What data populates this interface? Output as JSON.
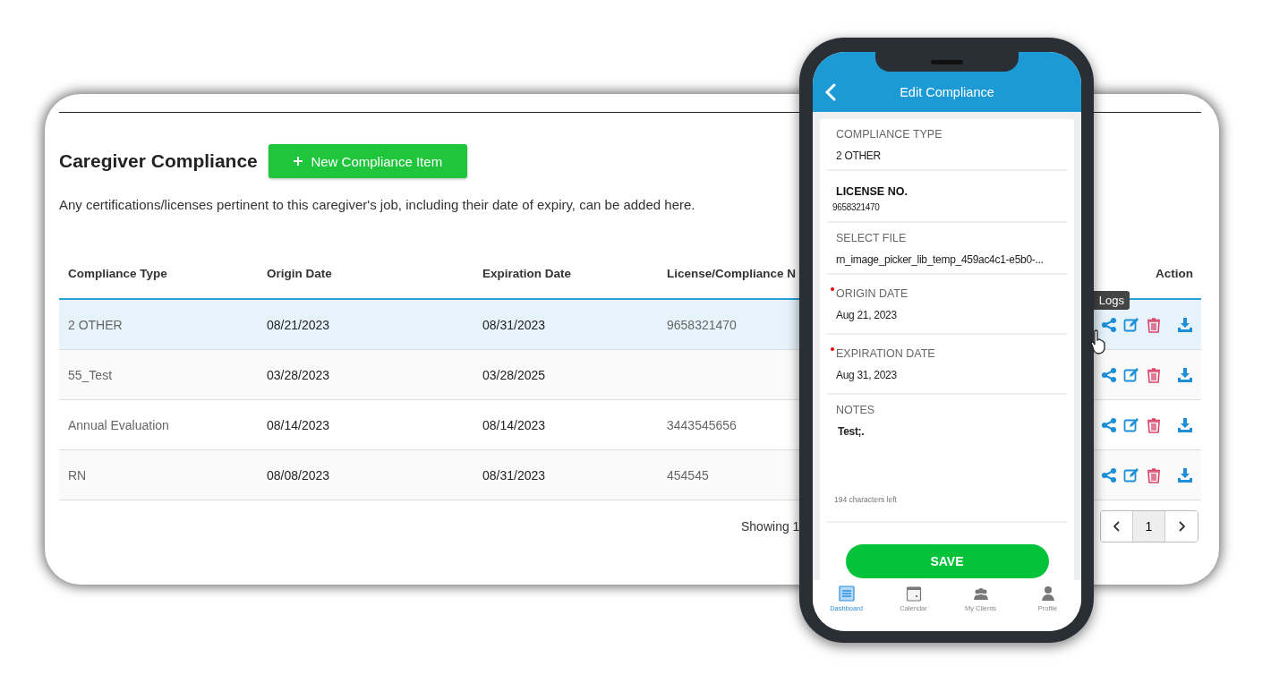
{
  "page": {
    "title": "Caregiver Compliance",
    "new_button": "New Compliance Item",
    "description": "Any certifications/licenses pertinent to this caregiver's job, including their date of expiry, can be added here."
  },
  "table": {
    "columns": [
      "Compliance Type",
      "Origin Date",
      "Expiration Date",
      "License/Compliance N",
      "Action"
    ],
    "rows": [
      {
        "type": "2 OTHER",
        "origin": "08/21/2023",
        "expiration": "08/31/2023",
        "license": "9658321470",
        "selected": true
      },
      {
        "type": "55_Test",
        "origin": "03/28/2023",
        "expiration": "03/28/2025",
        "selected": false
      },
      {
        "type": "Annual Evaluation",
        "origin": "08/14/2023",
        "expiration": "08/14/2023",
        "license": "3443545656",
        "selected": false
      },
      {
        "type": "RN",
        "origin": "08/08/2023",
        "expiration": "08/31/2023",
        "license": "454545",
        "selected": false
      }
    ]
  },
  "footer": {
    "showing": "Showing 1",
    "pages": [
      {
        "label": "1",
        "selected": true
      }
    ]
  },
  "tooltip": "Logs",
  "phone": {
    "title": "Edit Compliance",
    "fields": [
      {
        "kind": "plain",
        "label": "COMPLIANCE TYPE",
        "value": "2 OTHER",
        "required": false
      },
      {
        "kind": "strong",
        "label": "LICENSE NO.",
        "value": "9658321470",
        "required": false
      },
      {
        "kind": "plain",
        "label": "SELECT FILE",
        "value": "rn_image_picker_lib_temp_459ac4c1-e5b0-...",
        "required": false
      },
      {
        "kind": "plain",
        "label": "ORIGIN DATE",
        "value": "Aug 21, 2023",
        "required": true
      },
      {
        "kind": "plain",
        "label": "EXPIRATION DATE",
        "value": "Aug 31, 2023",
        "required": true
      },
      {
        "kind": "notes",
        "label": "NOTES",
        "value": "Test;.",
        "counter": "194  characters left",
        "required": false
      }
    ],
    "save": "SAVE",
    "nav": [
      {
        "label": "Dashboard",
        "selected": true
      },
      {
        "label": "Calendar",
        "selected": false
      },
      {
        "label": "My Clients",
        "selected": false
      },
      {
        "label": "Profile",
        "selected": false
      }
    ]
  }
}
